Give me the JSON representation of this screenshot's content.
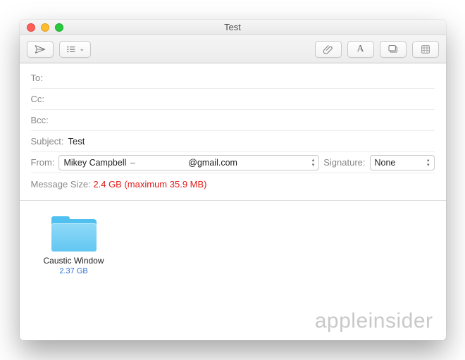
{
  "window": {
    "title": "Test"
  },
  "toolbar": {
    "send_icon": "paper-plane-icon",
    "format_icon": "list-bullets-icon",
    "attach_icon": "paperclip-icon",
    "font_icon": "A",
    "photo_icon": "photo-browser-icon",
    "emoji_icon": "emoji-icon"
  },
  "fields": {
    "to_label": "To:",
    "to_value": "",
    "cc_label": "Cc:",
    "cc_value": "",
    "bcc_label": "Bcc:",
    "bcc_value": "",
    "subject_label": "Subject:",
    "subject_value": "Test",
    "from_label": "From:",
    "from_name": "Mikey Campbell",
    "from_separator": " – ",
    "from_domain": "@gmail.com",
    "signature_label": "Signature:",
    "signature_value": "None",
    "size_label": "Message Size:",
    "size_warning": "2.4 GB (maximum 35.9 MB)"
  },
  "attachment": {
    "name": "Caustic Window",
    "size": "2.37 GB"
  },
  "watermark": "appleinsider"
}
